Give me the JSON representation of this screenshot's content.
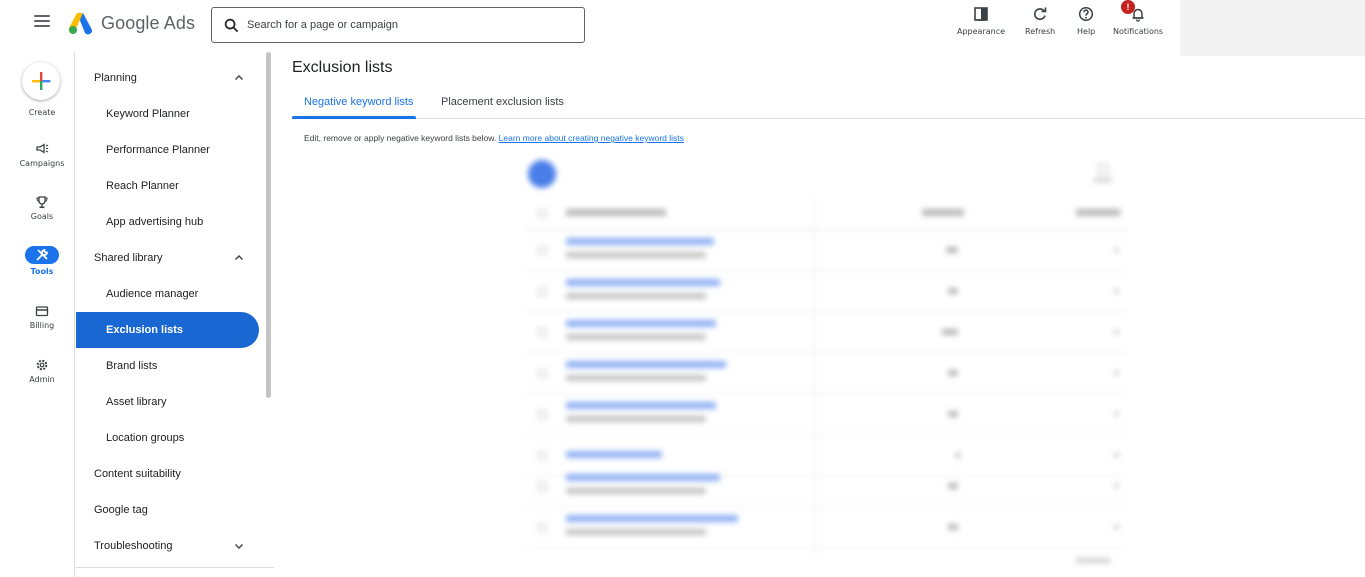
{
  "header": {
    "app_name": "Google Ads",
    "search_placeholder": "Search for a page or campaign",
    "tools": [
      {
        "label": "Appearance",
        "icon": "appearance-icon"
      },
      {
        "label": "Refresh",
        "icon": "refresh-icon"
      },
      {
        "label": "Help",
        "icon": "help-icon"
      },
      {
        "label": "Notifications",
        "icon": "bell-icon",
        "badge": "!"
      }
    ]
  },
  "rail": {
    "items": [
      {
        "label": "Create",
        "icon": "plus-icon"
      },
      {
        "label": "Campaigns",
        "icon": "megaphone-icon"
      },
      {
        "label": "Goals",
        "icon": "trophy-icon"
      },
      {
        "label": "Tools",
        "icon": "wrench-icon",
        "active": true
      },
      {
        "label": "Billing",
        "icon": "credit-card-icon"
      },
      {
        "label": "Admin",
        "icon": "gear-icon"
      }
    ]
  },
  "sidenav": {
    "items": [
      {
        "label": "Planning",
        "level": 1,
        "expanded": true
      },
      {
        "label": "Keyword Planner",
        "level": 2
      },
      {
        "label": "Performance Planner",
        "level": 2
      },
      {
        "label": "Reach Planner",
        "level": 2
      },
      {
        "label": "App advertising hub",
        "level": 2
      },
      {
        "label": "Shared library",
        "level": 1,
        "expanded": true
      },
      {
        "label": "Audience manager",
        "level": 2
      },
      {
        "label": "Exclusion lists",
        "level": 2,
        "active": true
      },
      {
        "label": "Brand lists",
        "level": 2
      },
      {
        "label": "Asset library",
        "level": 2
      },
      {
        "label": "Location groups",
        "level": 2
      },
      {
        "label": "Content suitability",
        "level": 1
      },
      {
        "label": "Google tag",
        "level": 1
      },
      {
        "label": "Troubleshooting",
        "level": 1,
        "expanded": false
      }
    ]
  },
  "main": {
    "title": "Exclusion lists",
    "tabs": [
      {
        "label": "Negative keyword lists",
        "active": true
      },
      {
        "label": "Placement exclusion lists"
      }
    ],
    "description": "Edit, remove or apply negative keyword lists below.",
    "description_link": "Learn more about creating negative keyword lists"
  },
  "colors": {
    "accent": "#1a73e8",
    "active_nav": "#1967d2",
    "badge": "#c5221f"
  }
}
